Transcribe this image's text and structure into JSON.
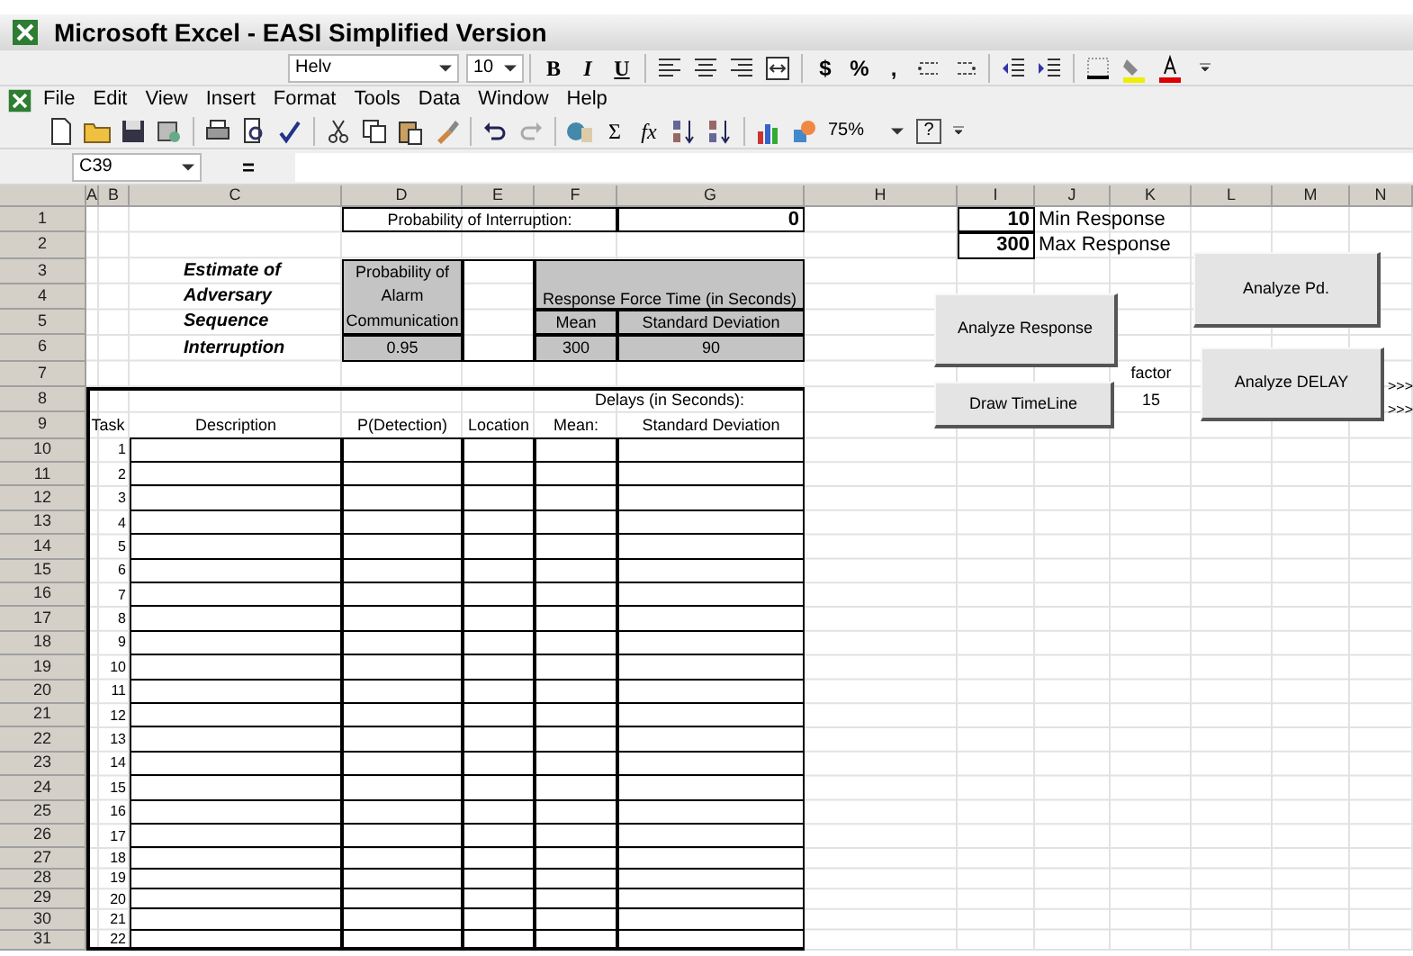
{
  "window": {
    "title": "Microsoft Excel - EASI Simplified Version"
  },
  "formatting_toolbar": {
    "font": "Helv",
    "font_size": "10",
    "style_buttons": [
      "B",
      "I",
      "U"
    ],
    "number_buttons": [
      "$",
      "%",
      ","
    ]
  },
  "menu_bar": [
    "File",
    "Edit",
    "View",
    "Insert",
    "Format",
    "Tools",
    "Data",
    "Window",
    "Help"
  ],
  "standard_toolbar": {
    "function_buttons": [
      "Σ",
      "fx"
    ],
    "zoom": "75%",
    "help": "?"
  },
  "formula_bar": {
    "name_box": "C39",
    "equals": "="
  },
  "sheet": {
    "columns": [
      "A",
      "B",
      "C",
      "D",
      "E",
      "F",
      "G",
      "H",
      "I",
      "J",
      "K",
      "L",
      "M",
      "N"
    ],
    "rows": [
      "1",
      "2",
      "3",
      "4",
      "5",
      "6",
      "7",
      "8",
      "9",
      "10",
      "11",
      "12",
      "13",
      "14",
      "15",
      "16",
      "17",
      "18",
      "19",
      "20",
      "21",
      "22",
      "23",
      "24",
      "25",
      "26",
      "27",
      "28",
      "29",
      "30",
      "31"
    ],
    "summary": {
      "label": "Probability of Interruption:",
      "value": "0"
    },
    "estimate_title": [
      "Estimate of",
      "Adversary",
      "Sequence",
      "Interruption"
    ],
    "alarm": {
      "label": [
        "Probability of",
        "Alarm",
        "Communication"
      ],
      "value": "0.95"
    },
    "response_force": {
      "title": "Response Force Time (in Seconds)",
      "mean_label": "Mean",
      "sd_label": "Standard Deviation",
      "mean": "300",
      "sd": "90"
    },
    "response_range": [
      {
        "reading": "10",
        "name": "Min Response"
      },
      {
        "reading": "300",
        "name": "Max Response"
      }
    ],
    "factor": {
      "label": "factor",
      "value": "15"
    },
    "task_table": {
      "group_header": "Delays (in Seconds):",
      "columns": [
        "Task",
        "Description",
        "P(Detection)",
        "Location",
        "Mean:",
        "Standard Deviation"
      ],
      "tasks": [
        "1",
        "2",
        "3",
        "4",
        "5",
        "6",
        "7",
        "8",
        "9",
        "10",
        "11",
        "12",
        "13",
        "14",
        "15",
        "16",
        "17",
        "18",
        "19",
        "20",
        "21",
        "22"
      ]
    }
  },
  "buttons": [
    "Analyze Pd.",
    "Analyze Response",
    "Draw TimeLine",
    "Analyze DELAY"
  ],
  "arrows": [
    ">>>",
    ">>>"
  ]
}
